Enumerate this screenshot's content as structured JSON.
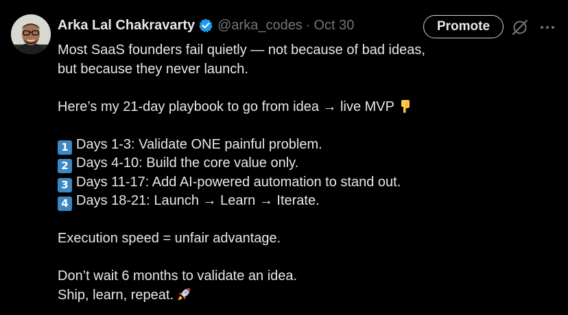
{
  "author": {
    "name": "Arka Lal Chakravarty",
    "handle": "@arka_codes",
    "separator": "·",
    "date": "Oct 30",
    "verified_color": "#1d9bf0"
  },
  "actions": {
    "promote_label": "Promote",
    "grok_icon": "grok-icon",
    "more_icon": "more-horizontal-icon"
  },
  "tweet": {
    "p1_line1": "Most SaaS founders fail quietly — not because of bad ideas,",
    "p1_line2": "but because they never launch.",
    "p2": "Here’s my 21-day playbook to go from idea → live MVP",
    "p2_emoji": "backhand-index-pointing-down",
    "steps": [
      {
        "number": "1",
        "text": "Days 1-3: Validate ONE painful problem."
      },
      {
        "number": "2",
        "text": "Days 4-10: Build the core value only."
      },
      {
        "number": "3",
        "text": "Days 11-17: Add AI-powered automation to stand out."
      },
      {
        "number": "4",
        "text": "Days 18-21: Launch → Learn → Iterate."
      }
    ],
    "p4": "Execution speed = unfair advantage.",
    "p5_line1": "Don’t wait 6 months to validate an idea.",
    "p5_line2": "Ship, learn, repeat.",
    "p5_emoji": "rocket"
  },
  "colors": {
    "background": "#000000",
    "text_primary": "#e7e9ea",
    "text_secondary": "#71767b",
    "keycap": "#3b88c3"
  }
}
